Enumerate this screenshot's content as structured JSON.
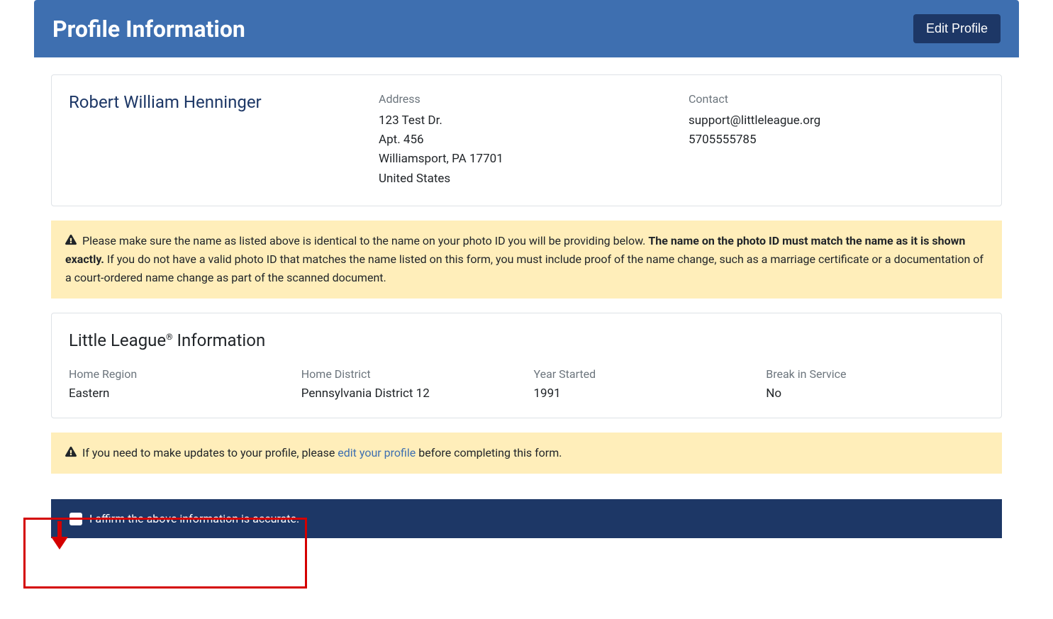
{
  "header": {
    "title": "Profile Information",
    "edit_button": "Edit Profile"
  },
  "profile": {
    "name": "Robert William Henninger",
    "address_label": "Address",
    "address": {
      "line1": "123 Test Dr.",
      "line2": "Apt. 456",
      "city_line": "Williamsport, PA 17701",
      "country": "United States"
    },
    "contact_label": "Contact",
    "contact": {
      "email": "support@littleleague.org",
      "phone": "5705555785"
    }
  },
  "alert1": {
    "text_before_bold": " Please make sure the name as listed above is identical to the name on your photo ID you will be providing below. ",
    "bold_text": "The name on the photo ID must match the name as it is shown exactly.",
    "text_after_bold": " If you do not have a valid photo ID that matches the name listed on this form, you must include proof of the name change, such as a marriage certificate or a documentation of a court-ordered name change as part of the scanned document."
  },
  "ll_section": {
    "title_prefix": "Little League",
    "title_suffix": " Information",
    "fields": [
      {
        "label": "Home Region",
        "value": "Eastern"
      },
      {
        "label": "Home District",
        "value": "Pennsylvania District 12"
      },
      {
        "label": "Year Started",
        "value": "1991"
      },
      {
        "label": "Break in Service",
        "value": "No"
      }
    ]
  },
  "alert2": {
    "text_before_link": " If you need to make updates to your profile, please ",
    "link_text": "edit your profile",
    "text_after_link": " before completing this form."
  },
  "affirm": {
    "label": "I affirm the above information is accurate."
  }
}
